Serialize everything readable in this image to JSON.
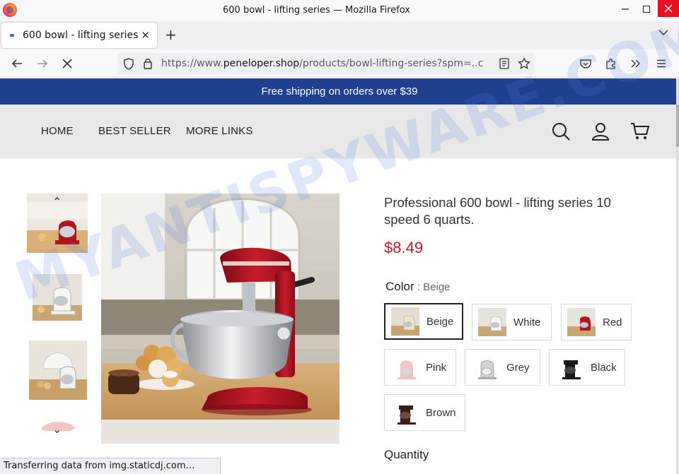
{
  "browser": {
    "window_title": "600 bowl - lifting series — Mozilla Firefox",
    "tab_title": "600 bowl - lifting series",
    "url_prefix": "https://www.",
    "url_host": "peneloper.shop",
    "url_path": "/products/bowl-lifting-series?spm=..c",
    "status_text": "Transferring data from img.staticdj.com…"
  },
  "site": {
    "announcement": "Free shipping on orders over $39",
    "nav": [
      "HOME",
      "BEST SELLER",
      "MORE LINKS"
    ]
  },
  "product": {
    "title": "Professional 600 bowl - lifting series 10 speed 6 quarts.",
    "price": "$8.49",
    "color_label": "Color",
    "color_sep": " : ",
    "color_value": "Beige",
    "swatches": [
      "Beige",
      "White",
      "Red",
      "Pink",
      "Grey",
      "Black",
      "Brown"
    ],
    "quantity_label": "Quantity"
  },
  "watermark": "MYANTISPYWARE.COM",
  "colors": {
    "announcement_bg": "#1f3f8f",
    "price": "#c41a2a",
    "mixer_red": "#b3121f"
  }
}
